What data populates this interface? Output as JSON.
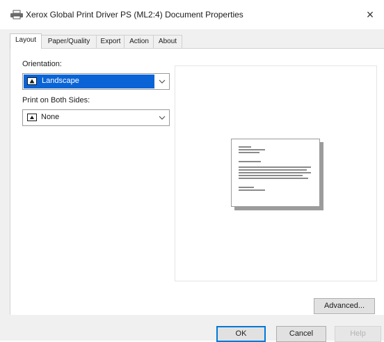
{
  "window": {
    "title": "Xerox Global Print Driver PS (ML2:4) Document Properties",
    "close_glyph": "×"
  },
  "tabs": [
    {
      "label": "Layout",
      "active": true
    },
    {
      "label": "Paper/Quality",
      "active": false
    },
    {
      "label": "Export",
      "active": false
    },
    {
      "label": "Action",
      "active": false
    },
    {
      "label": "About",
      "active": false
    }
  ],
  "layout": {
    "orientation_label": "Orientation:",
    "orientation_value": "Landscape",
    "duplex_label": "Print on Both Sides:",
    "duplex_value": "None",
    "advanced_label": "Advanced..."
  },
  "footer": {
    "ok_label": "OK",
    "cancel_label": "Cancel",
    "help_label": "Help"
  },
  "icons": {
    "title": "printer-icon",
    "orientation": "landscape-page-icon",
    "duplex": "single-sided-page-icon",
    "dropdown": "chevron-down-icon"
  },
  "colors": {
    "selection": "#0a64d6",
    "default_button_border": "#0078d7"
  }
}
